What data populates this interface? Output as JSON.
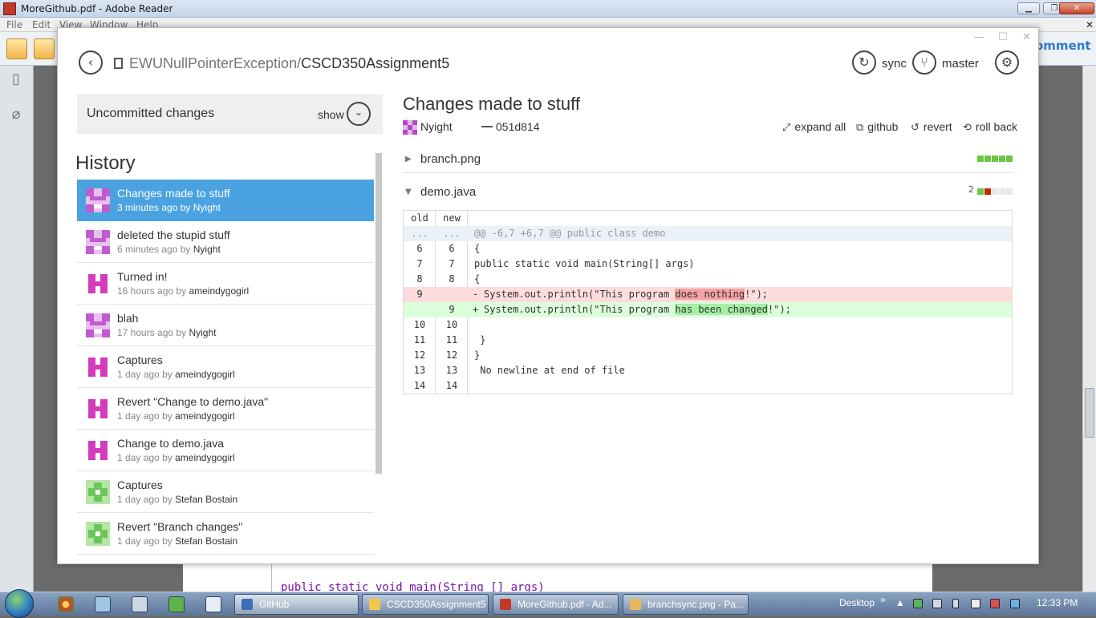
{
  "reader": {
    "window_title": "MoreGithub.pdf - Adobe Reader",
    "menu": [
      "File",
      "Edit",
      "View",
      "Window",
      "Help"
    ],
    "comment_label": "omment",
    "code_line": "public static void main(String [] args)"
  },
  "github": {
    "owner": "EWUNullPointerException",
    "separator": "/",
    "repo": "CSCD350Assignment5",
    "sync_label": "sync",
    "branch_label": "master",
    "uncommitted_label": "Uncommitted changes",
    "show_label": "show",
    "history_title": "History",
    "history": [
      {
        "message": "Changes made to stuff",
        "time": "3 minutes ago",
        "by": "by",
        "author": "Nyight",
        "avatar": "purple-grid"
      },
      {
        "message": "deleted the stupid stuff",
        "time": "6 minutes ago",
        "by": "by",
        "author": "Nyight",
        "avatar": "purple-grid"
      },
      {
        "message": "Turned in!",
        "time": "16 hours ago",
        "by": "by",
        "author": "ameindygogirl",
        "avatar": "magenta"
      },
      {
        "message": "blah",
        "time": "17 hours ago",
        "by": "by",
        "author": "Nyight",
        "avatar": "purple-grid"
      },
      {
        "message": "Captures",
        "time": "1 day ago",
        "by": "by",
        "author": "ameindygogirl",
        "avatar": "magenta"
      },
      {
        "message": "Revert \"Change to demo.java\"",
        "time": "1 day ago",
        "by": "by",
        "author": "ameindygogirl",
        "avatar": "magenta"
      },
      {
        "message": "Change to demo.java",
        "time": "1 day ago",
        "by": "by",
        "author": "ameindygogirl",
        "avatar": "magenta"
      },
      {
        "message": "Captures",
        "time": "1 day ago",
        "by": "by",
        "author": "Stefan Bostain",
        "avatar": "green-cross"
      },
      {
        "message": "Revert \"Branch changes\"",
        "time": "1 day ago",
        "by": "by",
        "author": "Stefan Bostain",
        "avatar": "green-cross"
      }
    ],
    "commit": {
      "title": "Changes made to stuff",
      "author": "Nyight",
      "sha": "051d814",
      "actions": {
        "expand_all": "expand all",
        "github": "github",
        "revert": "revert",
        "roll_back": "roll back"
      }
    },
    "files": [
      {
        "name": "branch.png",
        "expanded": false
      },
      {
        "name": "demo.java",
        "expanded": true,
        "changes": "2"
      }
    ],
    "diff": {
      "old_header": "old",
      "new_header": "new",
      "hunk_old": "...",
      "hunk_new": "...",
      "hunk_text": "@@ -6,7 +6,7 @@ public class demo",
      "rows": [
        {
          "old": "6",
          "new": "6",
          "text": "{"
        },
        {
          "old": "7",
          "new": "7",
          "text": "public static void main(String[] args)"
        },
        {
          "old": "8",
          "new": "8",
          "text": "{"
        },
        {
          "old": "10",
          "new": "10",
          "text": ""
        },
        {
          "old": "11",
          "new": "11",
          "text": " }"
        },
        {
          "old": "12",
          "new": "12",
          "text": "}"
        },
        {
          "old": "13",
          "new": "13",
          "text": " No newline at end of file"
        },
        {
          "old": "14",
          "new": "14",
          "text": ""
        }
      ],
      "deleted": {
        "old": "9",
        "sign": "-",
        "pre": "System.out.println(\"This program ",
        "changed": "does nothing",
        "post": "!\");"
      },
      "added": {
        "new": "9",
        "sign": "+",
        "pre": "System.out.println(\"This program ",
        "changed": "has been changed",
        "post": "!\");"
      }
    }
  },
  "taskbar": {
    "buttons": [
      "GitHub",
      "CSCD350Assignment5",
      "MoreGithub.pdf - Ad...",
      "branchsync.png - Pa..."
    ],
    "desktop_label": "Desktop",
    "chevron": "»",
    "clock": "12:33 PM"
  },
  "colors": {
    "selected_row": "#4aa3e0",
    "added_bg": "#dbffdb",
    "deleted_bg": "#ffdddd",
    "hunk_bg": "#eaf1f8",
    "stat_green": "#6cc644",
    "stat_red": "#bd2c00"
  }
}
